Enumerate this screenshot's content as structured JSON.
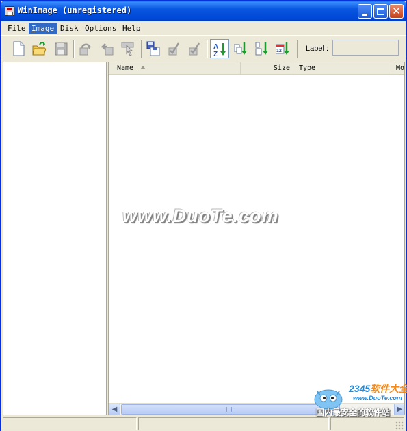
{
  "window": {
    "title": "WinImage (unregistered)"
  },
  "menu": [
    {
      "label": "File",
      "active": false
    },
    {
      "label": "Image",
      "active": true
    },
    {
      "label": "Disk",
      "active": false
    },
    {
      "label": "Options",
      "active": false
    },
    {
      "label": "Help",
      "active": false
    }
  ],
  "toolbar": {
    "buttons": [
      "new-document",
      "open-folder",
      "save-disk",
      "redo-arrow",
      "undo-arrow",
      "select-pointer",
      "write-disk",
      "checkmark-edit",
      "checkmark-disabled",
      "sort-az",
      "sort-type",
      "sort-size",
      "sort-date"
    ],
    "label_caption": "Label :",
    "label_value": ""
  },
  "file_list": {
    "columns": [
      "Name",
      "Size",
      "Type",
      "Mo"
    ],
    "sorted_by": "Name",
    "sort_direction": "ascending",
    "rows": []
  },
  "status_bar": {
    "panels": [
      "",
      "",
      ""
    ]
  },
  "watermarks": {
    "duote": "www.DuoTe.com",
    "brand_digits": "2345",
    "brand_text": "软件大全",
    "brand_url": "www.DuoTe.com",
    "slogan": "国内最安全的软件站"
  },
  "colors": {
    "titlebar": "#0A57E0",
    "menu_highlight": "#316AC5",
    "sort_arrow_green": "#1F9A2E"
  }
}
